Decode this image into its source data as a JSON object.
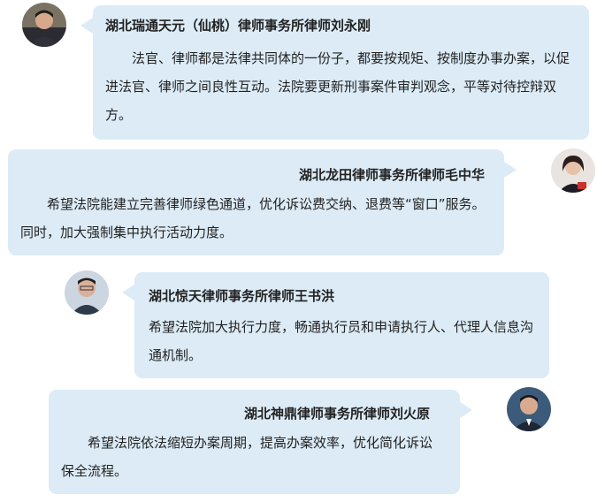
{
  "messages": [
    {
      "name": "湖北瑞通天元（仙桃）律师事务所律师刘永刚",
      "text": "法官、律师都是法律共同体的一份子，都要按规矩、按制度办事办案，以促进法官、律师之间良性互动。法院要更新刑事案件审判观念，平等对待控辩双方。"
    },
    {
      "name": "湖北龙田律师事务所律师毛中华",
      "text": "希望法院能建立完善律师绿色通道，优化诉讼费交纳、退费等“窗口”服务。同时，加大强制集中执行活动力度。"
    },
    {
      "name": "湖北惊天律师事务所律师王书洪",
      "text": "希望法院加大执行力度，畅通执行员和申请执行人、代理人信息沟通机制。"
    },
    {
      "name": "湖北神鼎律师事务所律师刘火原",
      "text": "希望法院依法缩短办案周期，提高办案效率，优化简化诉讼保全流程。"
    }
  ],
  "colors": {
    "bubble": "#dcebf6"
  }
}
